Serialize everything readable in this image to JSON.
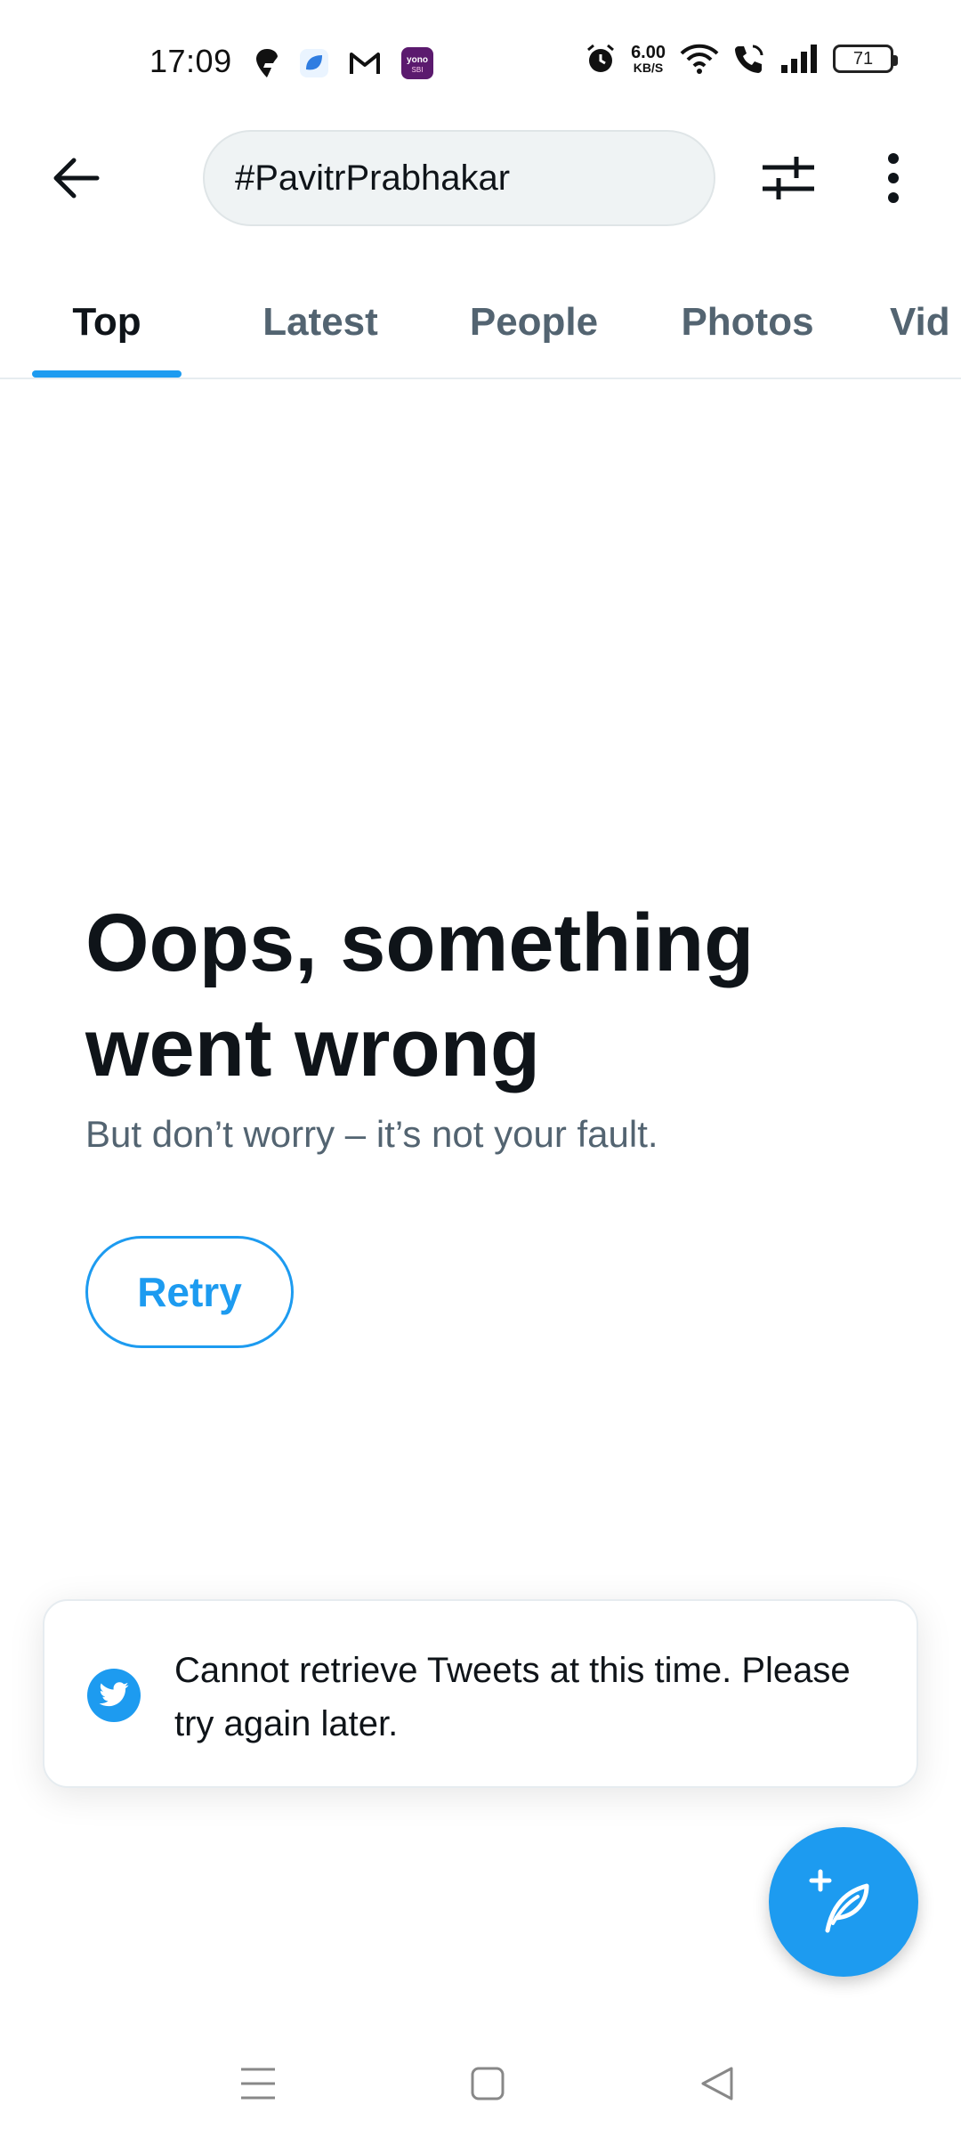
{
  "status_bar": {
    "time": "17:09",
    "net_speed_value": "6.00",
    "net_speed_unit": "KB/S",
    "battery_level": "71",
    "left_icons": [
      "swiggy-icon",
      "app-icon",
      "gmail-icon",
      "yono-sbi-icon"
    ],
    "right_icons": [
      "alarm-icon",
      "wifi-icon",
      "wifi-call-icon",
      "signal-icon",
      "battery-icon"
    ],
    "yono_label": "yono"
  },
  "app_bar": {
    "search_query": "#PavitrPrabhakar"
  },
  "tabs": [
    {
      "label": "Top",
      "active": true
    },
    {
      "label": "Latest",
      "active": false
    },
    {
      "label": "People",
      "active": false
    },
    {
      "label": "Photos",
      "active": false
    },
    {
      "label": "Vid",
      "active": false
    }
  ],
  "error": {
    "title": "Oops, something went wrong",
    "subtitle": "But don’t worry – it’s not your fault.",
    "retry_label": "Retry"
  },
  "toast": {
    "message": "Cannot retrieve Tweets at this time. Please try again later."
  },
  "colors": {
    "accent": "#1d9bf0",
    "text_primary": "#0f1419",
    "text_secondary": "#536471"
  }
}
